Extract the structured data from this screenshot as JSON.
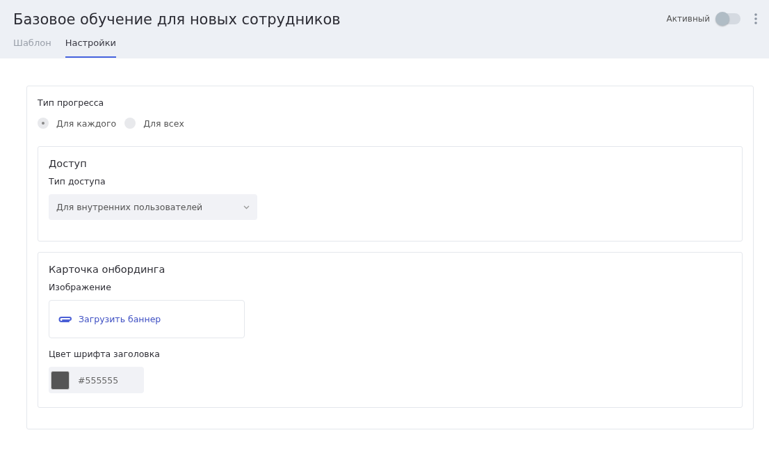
{
  "header": {
    "title": "Базовое обучение для новых сотрудников",
    "active_label": "Активный",
    "active_toggle": {
      "on": false
    }
  },
  "tabs": [
    {
      "label": "Шаблон",
      "selected": false
    },
    {
      "label": "Настройки",
      "selected": true
    }
  ],
  "progress_type": {
    "label": "Тип прогресса",
    "options": [
      {
        "label": "Для каждого",
        "selected": true
      },
      {
        "label": "Для всех",
        "selected": false
      }
    ]
  },
  "access": {
    "title": "Доступ",
    "field_label": "Тип доступа",
    "value": "Для внутренних пользователей"
  },
  "onboarding_card": {
    "title": "Карточка онбординга",
    "image_label": "Изображение",
    "upload_link": "Загрузить баннер",
    "color_label": "Цвет шрифта заголовка",
    "color_value": "#555555"
  }
}
